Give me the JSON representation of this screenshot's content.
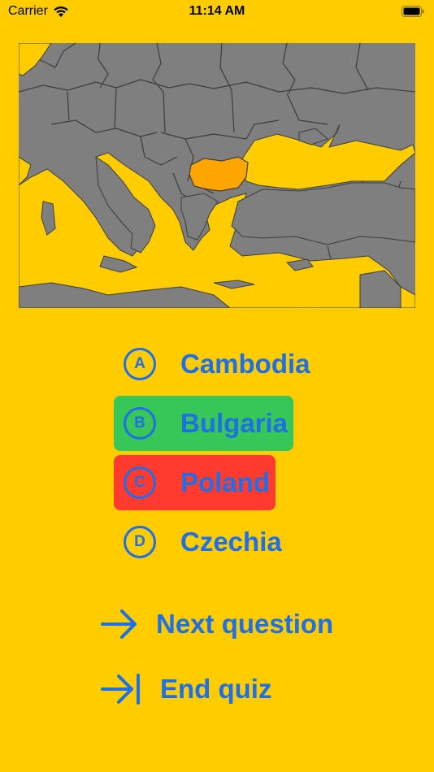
{
  "status_bar": {
    "carrier": "Carrier",
    "time": "11:14 AM"
  },
  "map": {
    "highlighted_country": "Bulgaria",
    "colors": {
      "land": "#7f7f7f",
      "water": "#ffcc00",
      "highlight": "#ffa500",
      "border": "#3a3a3a"
    }
  },
  "quiz": {
    "options": [
      {
        "letter": "A",
        "label": "Cambodia",
        "state": "neutral"
      },
      {
        "letter": "B",
        "label": "Bulgaria",
        "state": "correct"
      },
      {
        "letter": "C",
        "label": "Poland",
        "state": "wrong"
      },
      {
        "letter": "D",
        "label": "Czechia",
        "state": "neutral"
      }
    ]
  },
  "actions": {
    "next_label": "Next question",
    "end_label": "End quiz"
  },
  "colors": {
    "background": "#ffcc00",
    "accent": "#1e6fe8",
    "correct": "#36c758",
    "wrong": "#ff3b30"
  }
}
